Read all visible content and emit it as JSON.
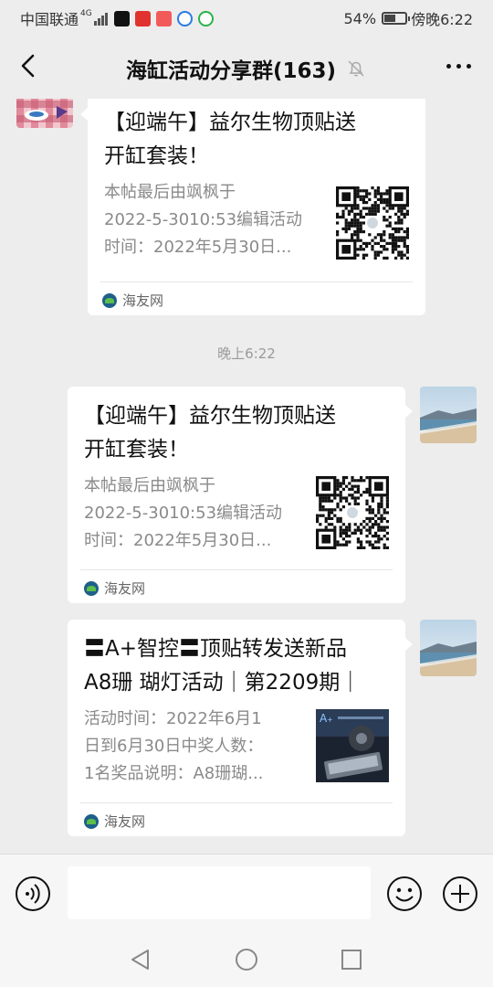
{
  "status_bar": {
    "carrier": "中国联通",
    "network": "4G",
    "battery_percent": "54%",
    "battery_level": 0.54,
    "time": "傍晚6:22",
    "notif_icons": [
      "tiktok-icon",
      "toutiao-icon",
      "app-red-icon",
      "lightbulb-icon",
      "message-icon"
    ]
  },
  "header": {
    "title": "海缸活动分享群(163)",
    "back_icon": "chevron-left-icon",
    "mute_icon": "bell-off-icon",
    "more_icon": "more-horizontal-icon"
  },
  "messages": [
    {
      "side": "left",
      "title_lines": [
        "【迎端午】益尔生物顶贴送",
        "开缸套装！"
      ],
      "desc_lines": [
        "本帖最后由飒枫于",
        "2022-5-3010:53编辑活动",
        "时间：2022年5月30日..."
      ],
      "source": "海友网",
      "thumbnail": "qr-code"
    },
    {
      "side": "right",
      "title_lines": [
        "【迎端午】益尔生物顶贴送",
        "开缸套装！"
      ],
      "desc_lines": [
        "本帖最后由飒枫于",
        "2022-5-3010:53编辑活动",
        "时间：2022年5月30日..."
      ],
      "source": "海友网",
      "thumbnail": "qr-code"
    },
    {
      "side": "right",
      "title_lines": [
        "〓A+智控〓顶贴转发送新品",
        "A8珊 瑚灯活动｜第2209期｜"
      ],
      "desc_lines": [
        "活动时间：2022年6月1",
        "日到6月30日中奖人数：",
        "1名奖品说明：A8珊瑚..."
      ],
      "source": "海友网",
      "thumbnail": "product-photo"
    }
  ],
  "timestamp": "晚上6:22",
  "input_bar": {
    "voice_icon": "voice-icon",
    "emoji_icon": "emoji-icon",
    "plus_icon": "plus-circle-icon",
    "placeholder": ""
  },
  "nav_bar": {
    "back_icon": "nav-back-icon",
    "home_icon": "nav-home-icon",
    "recents_icon": "nav-recents-icon"
  },
  "colors": {
    "background": "#ededed",
    "card": "#ffffff",
    "muted_text": "#8a8a8a"
  }
}
